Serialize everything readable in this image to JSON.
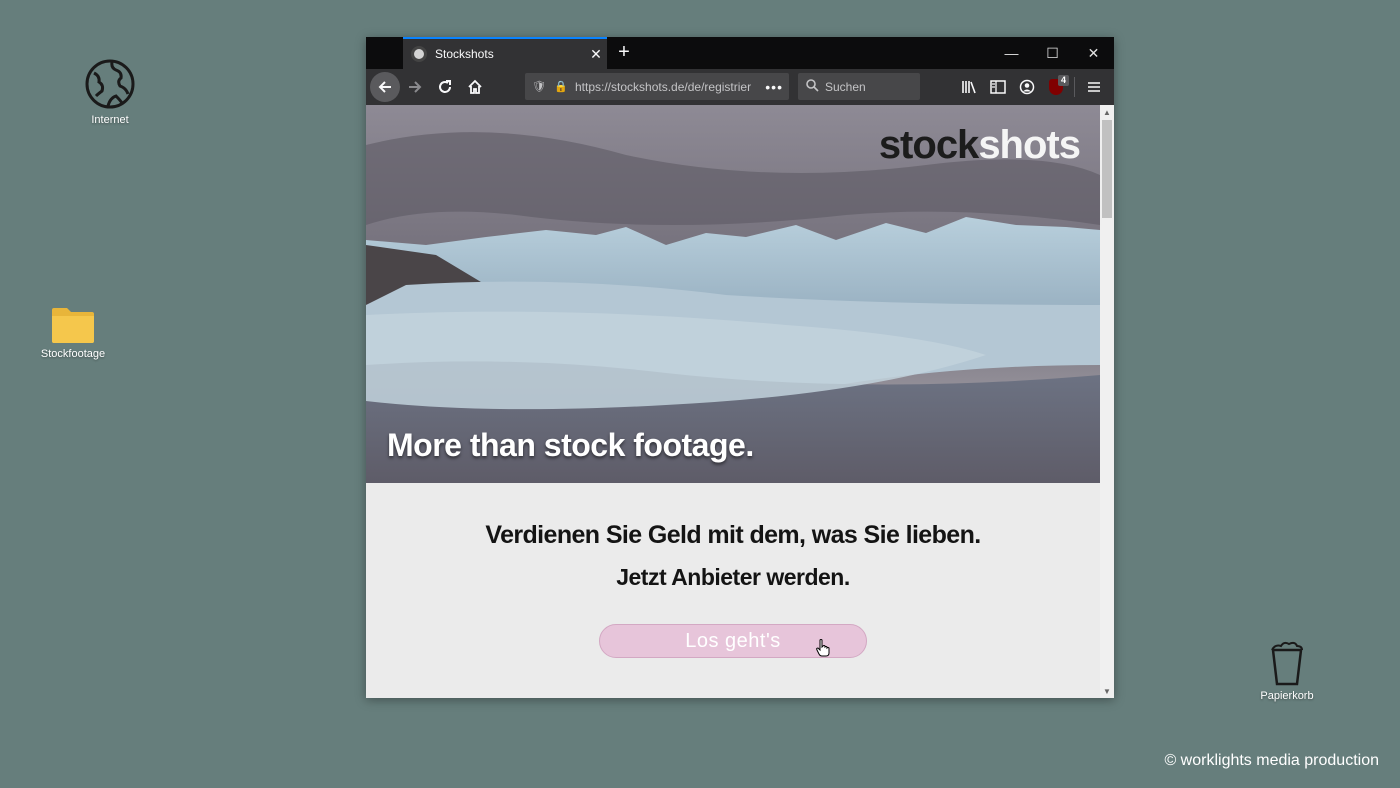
{
  "desktop": {
    "icons": [
      {
        "label": "Internet",
        "icon": "globe-icon"
      },
      {
        "label": "Stockfootage",
        "icon": "folder-icon"
      },
      {
        "label": "Papierkorb",
        "icon": "trash-icon"
      }
    ],
    "copyright": "© worklights media production"
  },
  "browser": {
    "tab": {
      "title": "Stockshots",
      "close": "✕"
    },
    "new_tab": "+",
    "window_controls": {
      "minimize": "—",
      "maximize": "☐",
      "close": "✕"
    },
    "url": "https://stockshots.de/de/registrier",
    "url_more": "•••",
    "search_placeholder": "Suchen",
    "ublock_badge": "4"
  },
  "page": {
    "logo": {
      "part1": "stock",
      "part2": "shots"
    },
    "tagline": "More than stock footage.",
    "headline": "Verdienen Sie Geld mit dem, was Sie lieben.",
    "subheadline": "Jetzt Anbieter werden.",
    "cta_label": "Los geht's"
  },
  "colors": {
    "desktop_bg": "#667e7c",
    "cta_bg": "#e7c5da",
    "tab_accent": "#0a84ff"
  }
}
